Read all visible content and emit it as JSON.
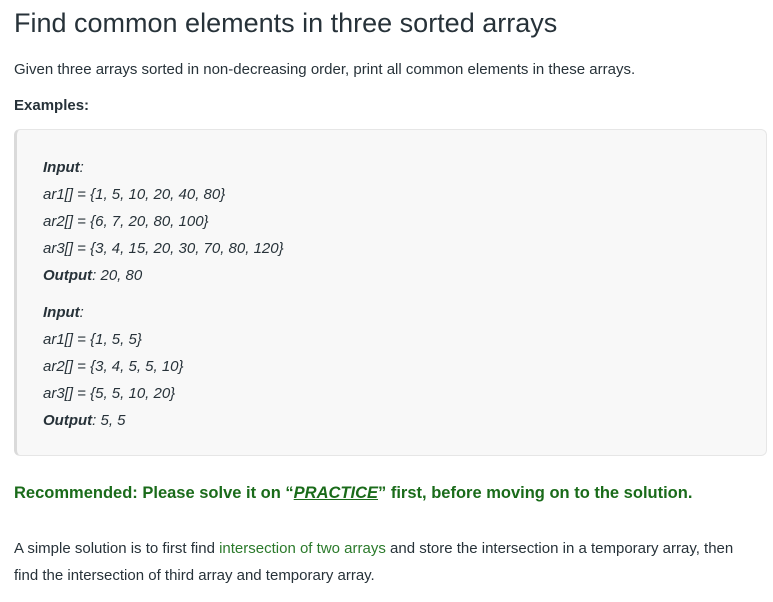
{
  "article": {
    "title": "Find common elements in three sorted arrays",
    "intro": "Given three arrays sorted in non-decreasing order, print all common elements in these arrays.",
    "examples_label": "Examples:",
    "examples": [
      {
        "input_key": "Input",
        "input_colon": ":",
        "ar1": "ar1[] = {1, 5, 10, 20, 40, 80}",
        "ar2": "ar2[] = {6, 7, 20, 80, 100}",
        "ar3": "ar3[] = {3, 4, 15, 20, 30, 70, 80, 120}",
        "output_key": "Output",
        "output_value": ": 20, 80"
      },
      {
        "input_key": "Input",
        "input_colon": ":",
        "ar1": "ar1[] = {1, 5, 5}",
        "ar2": "ar2[] = {3, 4, 5, 5, 10}",
        "ar3": "ar3[] = {5, 5, 10, 20}",
        "output_key": "Output",
        "output_value": ": 5, 5"
      }
    ],
    "recommend": {
      "prefix": "Recommended: Please solve it on “",
      "link": "PRACTICE",
      "suffix": "” first, before moving on to the solution."
    },
    "solution": {
      "part1": "A simple solution is to first find ",
      "link": "intersection of two arrays",
      "part2": " and store the intersection in a temporary array, then find the intersection of third array and temporary array."
    }
  },
  "colors": {
    "text": "#273239",
    "recommend_green": "#1a6b1a",
    "link_green": "#2b7a2b",
    "box_bg": "#f8f8f8"
  }
}
